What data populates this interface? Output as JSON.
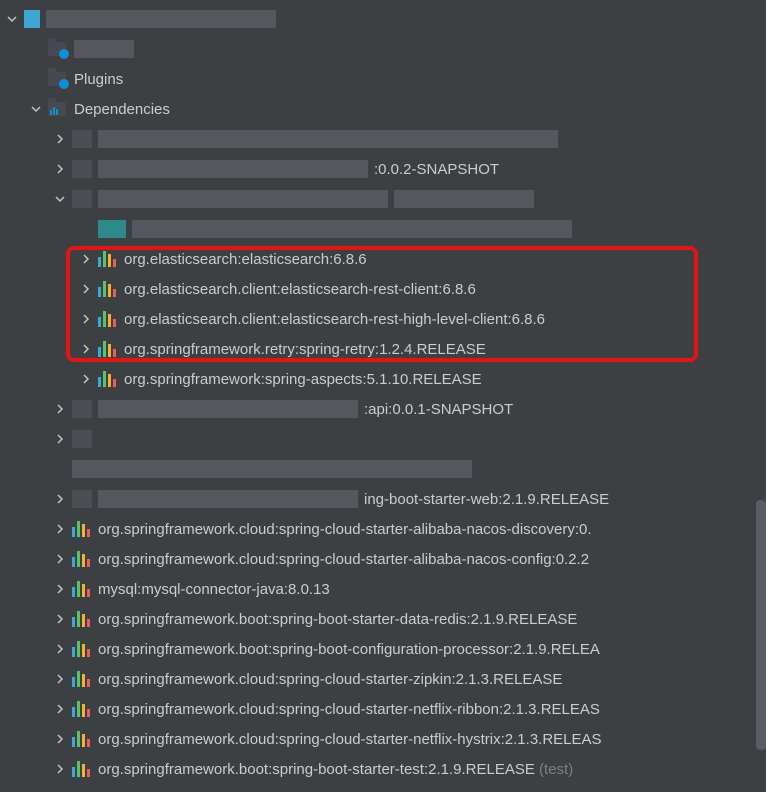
{
  "nodes": {
    "plugins": "Plugins",
    "dependencies": "Dependencies"
  },
  "partial": {
    "snapshot1": ":0.0.2-SNAPSHOT",
    "api": ":api:0.0.1-SNAPSHOT",
    "starterweb": "ing-boot-starter-web:2.1.9.RELEASE"
  },
  "deps": {
    "es": "org.elasticsearch:elasticsearch:6.8.6",
    "esrest": "org.elasticsearch.client:elasticsearch-rest-client:6.8.6",
    "eshigh": "org.elasticsearch.client:elasticsearch-rest-high-level-client:6.8.6",
    "retry": "org.springframework.retry:spring-retry:1.2.4.RELEASE",
    "aspects": "org.springframework:spring-aspects:5.1.10.RELEASE",
    "nacosdisc": "org.springframework.cloud:spring-cloud-starter-alibaba-nacos-discovery:0.",
    "nacosconf": "org.springframework.cloud:spring-cloud-starter-alibaba-nacos-config:0.2.2",
    "mysql": "mysql:mysql-connector-java:8.0.13",
    "redis": "org.springframework.boot:spring-boot-starter-data-redis:2.1.9.RELEASE",
    "confproc": "org.springframework.boot:spring-boot-configuration-processor:2.1.9.RELEA",
    "zipkin": "org.springframework.cloud:spring-cloud-starter-zipkin:2.1.3.RELEASE",
    "ribbon": "org.springframework.cloud:spring-cloud-starter-netflix-ribbon:2.1.3.RELEAS",
    "hystrix": "org.springframework.cloud:spring-cloud-starter-netflix-hystrix:2.1.3.RELEAS",
    "test": "org.springframework.boot:spring-boot-starter-test:2.1.9.RELEASE",
    "testscope": "(test)"
  }
}
